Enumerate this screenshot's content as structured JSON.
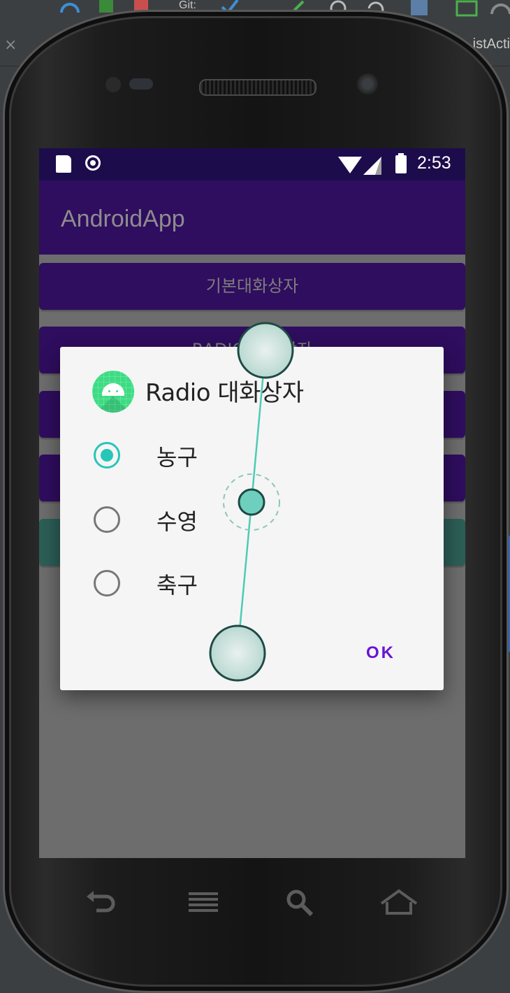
{
  "ide": {
    "tab_label": "istActi",
    "close_glyph": "×",
    "toolbar_text": "Git:"
  },
  "statusbar": {
    "time": "2:53",
    "icons": [
      "sd-card-icon",
      "record-icon",
      "wifi-icon",
      "signal-icon",
      "battery-icon"
    ]
  },
  "app": {
    "title": "AndroidApp"
  },
  "buttons": [
    {
      "label": "기본대화상자"
    },
    {
      "label": "RADIO 대화상자"
    },
    {
      "label": ""
    },
    {
      "label": ""
    },
    {
      "label": ""
    }
  ],
  "dialog": {
    "title": "Radio 대화상자",
    "options": [
      {
        "label": "농구",
        "checked": true
      },
      {
        "label": "수영",
        "checked": false
      },
      {
        "label": "축구",
        "checked": false
      }
    ],
    "ok_label": "OK"
  },
  "nav": {
    "icons": [
      "back-icon",
      "menu-icon",
      "search-icon",
      "home-icon"
    ]
  },
  "colors": {
    "primary": "#2f0d5f",
    "statusbar": "#1d0c4c",
    "accent_radio": "#26c6b8",
    "ok_text": "#6b13d6",
    "dialog_bg": "#f5f5f5"
  }
}
